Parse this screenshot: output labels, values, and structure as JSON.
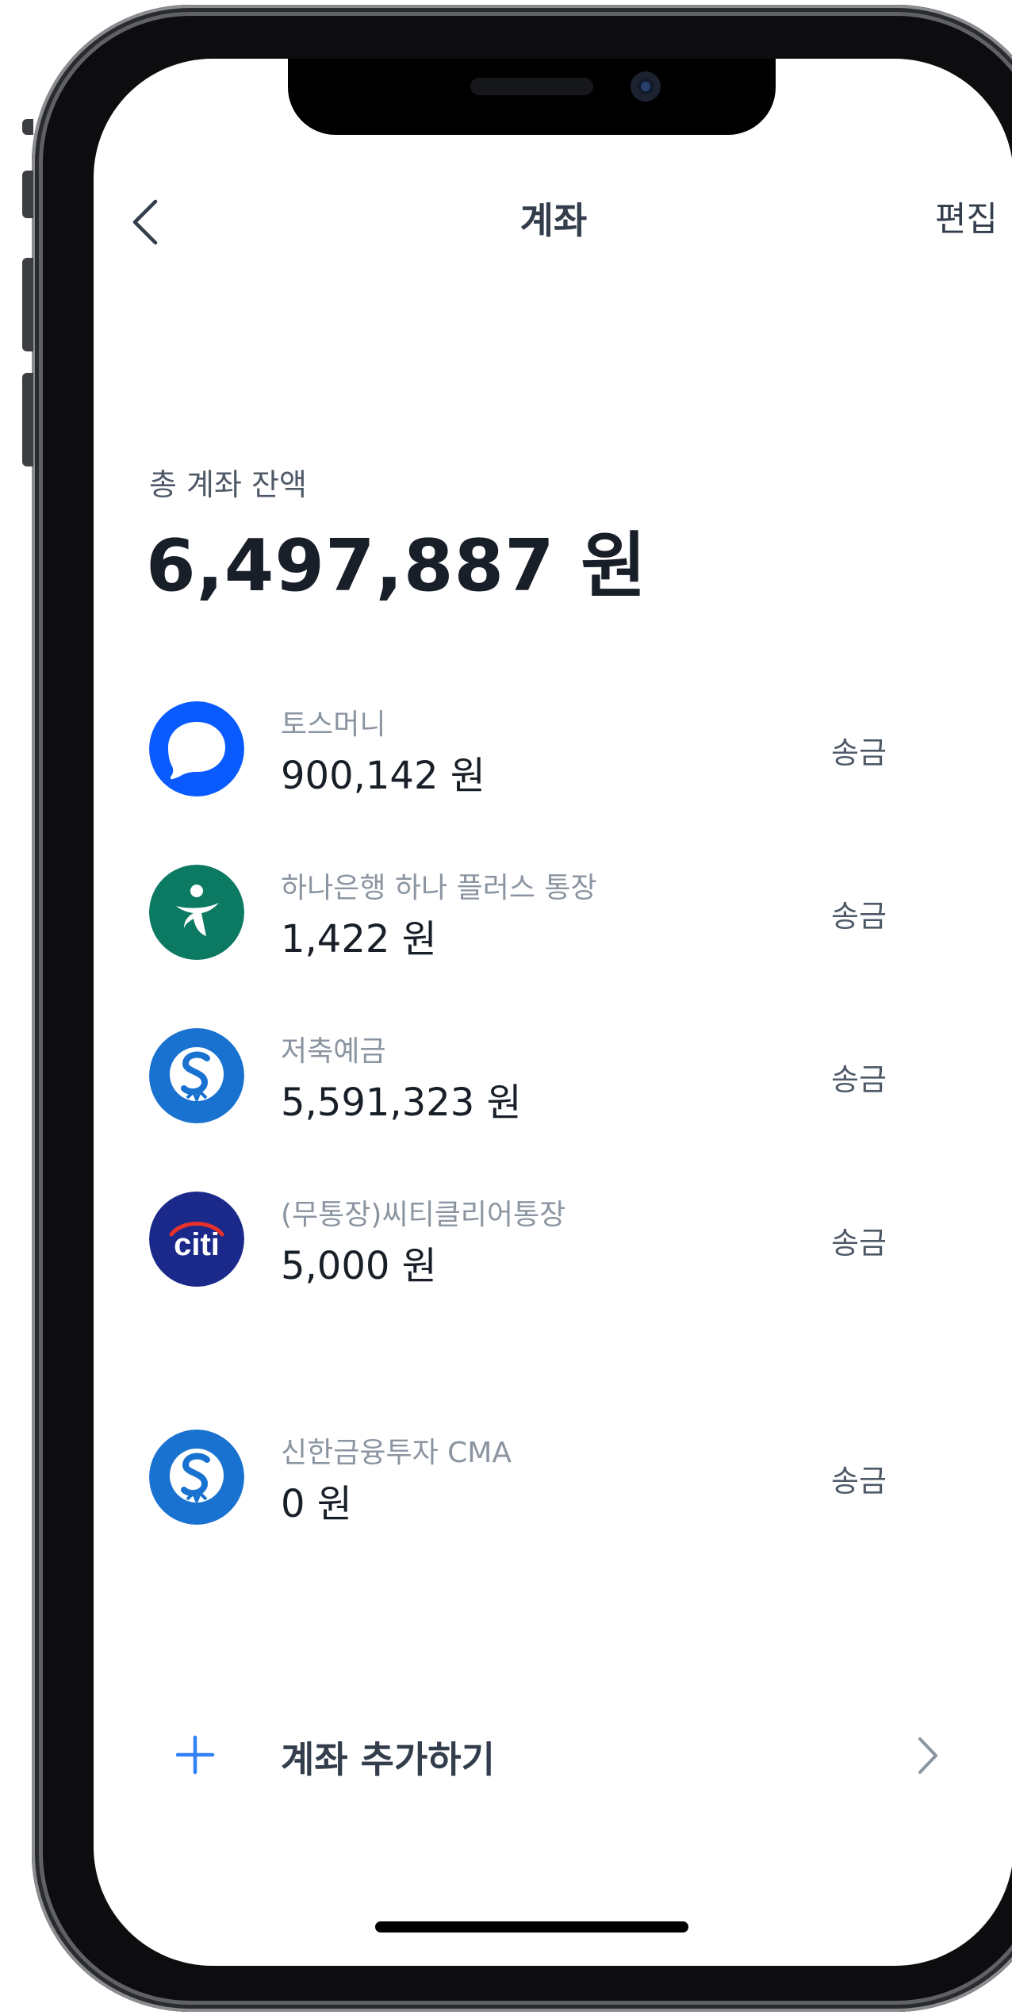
{
  "header": {
    "title": "계좌",
    "edit_label": "편집"
  },
  "summary": {
    "label": "총 계좌 잔액",
    "amount": "6,497,887 원"
  },
  "accounts": [
    {
      "name": "토스머니",
      "amount": "900,142 원",
      "action": "송금",
      "icon": "toss-logo-icon"
    },
    {
      "name": "하나은행 하나 플러스 통장",
      "amount": "1,422 원",
      "action": "송금",
      "icon": "hana-bank-logo-icon"
    },
    {
      "name": "저축예금",
      "amount": "5,591,323 원",
      "action": "송금",
      "icon": "shinhan-logo-icon"
    },
    {
      "name": "(무통장)씨티클리어통장",
      "amount": "5,000 원",
      "action": "송금",
      "icon": "citi-logo-icon",
      "logo_text": "citi"
    },
    {
      "name": "신한금융투자 CMA",
      "amount": "0 원",
      "action": "송금",
      "icon": "shinhan-logo-icon"
    }
  ],
  "add_account": {
    "label": "계좌 추가하기"
  },
  "colors": {
    "toss_blue": "#0a5bff",
    "hana_green": "#0c7a63",
    "shinhan_blue": "#1a72d0",
    "citi_navy": "#1b2a8a",
    "accent_blue": "#3182f6"
  }
}
